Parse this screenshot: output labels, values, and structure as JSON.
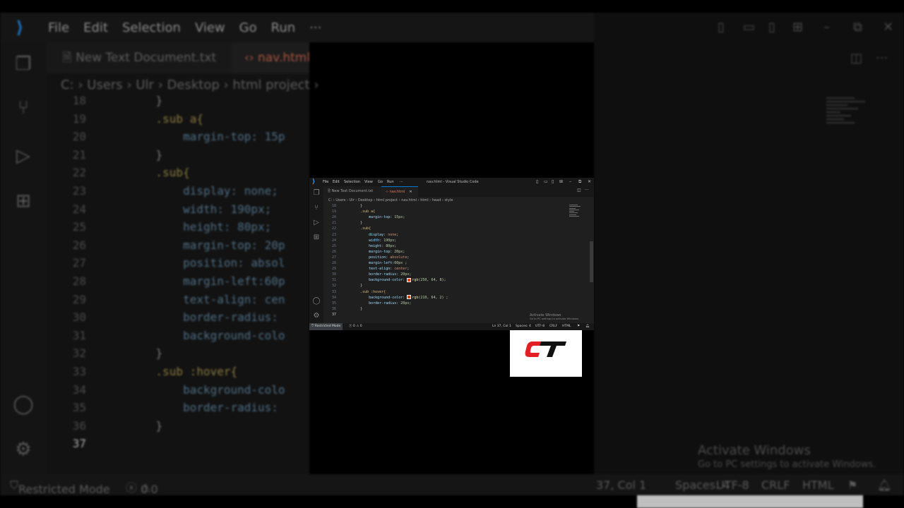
{
  "menu": [
    "File",
    "Edit",
    "Selection",
    "View",
    "Go",
    "Run",
    "···"
  ],
  "tabs": {
    "inactive": "New Text Document.txt",
    "active": "nav.html",
    "active_bg_visible": "nav.html"
  },
  "window_title": "nav.html - Visual Studio Code",
  "breadcrumb": {
    "bg": "C: › Users › Ulr › Desktop › html project ›",
    "small": [
      "C:",
      "Users",
      "Ulr",
      "Desktop",
      "html project",
      "nav.html",
      "html",
      "head",
      "style"
    ]
  },
  "code_lines": [
    {
      "n": "18",
      "parts": [
        {
          "t": "        }",
          "c": "txt"
        }
      ]
    },
    {
      "n": "19",
      "parts": [
        {
          "t": "        .sub a{",
          "c": "sel"
        }
      ]
    },
    {
      "n": "20",
      "parts": [
        {
          "t": "            margin-top",
          "c": "prop"
        },
        {
          "t": ": ",
          "c": "txt"
        },
        {
          "t": "15px",
          "c": "num"
        },
        {
          "t": ";",
          "c": "txt"
        }
      ]
    },
    {
      "n": "21",
      "parts": [
        {
          "t": "        }",
          "c": "txt"
        }
      ]
    },
    {
      "n": "22",
      "parts": [
        {
          "t": "        .sub{",
          "c": "sel"
        }
      ]
    },
    {
      "n": "23",
      "parts": [
        {
          "t": "            display",
          "c": "prop"
        },
        {
          "t": ": ",
          "c": "txt"
        },
        {
          "t": "none",
          "c": "val"
        },
        {
          "t": ";",
          "c": "txt"
        }
      ]
    },
    {
      "n": "24",
      "parts": [
        {
          "t": "            width",
          "c": "prop"
        },
        {
          "t": ": ",
          "c": "txt"
        },
        {
          "t": "190px",
          "c": "num"
        },
        {
          "t": ";",
          "c": "txt"
        }
      ]
    },
    {
      "n": "25",
      "parts": [
        {
          "t": "            height",
          "c": "prop"
        },
        {
          "t": ": ",
          "c": "txt"
        },
        {
          "t": "80px",
          "c": "num"
        },
        {
          "t": ";",
          "c": "txt"
        }
      ]
    },
    {
      "n": "26",
      "parts": [
        {
          "t": "            margin-top",
          "c": "prop"
        },
        {
          "t": ": ",
          "c": "txt"
        },
        {
          "t": "20px",
          "c": "num"
        },
        {
          "t": ";",
          "c": "txt"
        }
      ]
    },
    {
      "n": "27",
      "parts": [
        {
          "t": "            position",
          "c": "prop"
        },
        {
          "t": ": ",
          "c": "txt"
        },
        {
          "t": "absolute",
          "c": "val"
        },
        {
          "t": ";",
          "c": "txt"
        }
      ]
    },
    {
      "n": "28",
      "parts": [
        {
          "t": "            margin-left",
          "c": "prop"
        },
        {
          "t": ":",
          "c": "txt"
        },
        {
          "t": "60px",
          "c": "num"
        },
        {
          "t": " ;",
          "c": "txt"
        }
      ]
    },
    {
      "n": "29",
      "parts": [
        {
          "t": "            text-align",
          "c": "prop"
        },
        {
          "t": ": ",
          "c": "txt"
        },
        {
          "t": "center",
          "c": "val"
        },
        {
          "t": ";",
          "c": "txt"
        }
      ]
    },
    {
      "n": "30",
      "parts": [
        {
          "t": "            border-radius",
          "c": "prop"
        },
        {
          "t": ": ",
          "c": "txt"
        },
        {
          "t": "20px",
          "c": "num"
        },
        {
          "t": ";",
          "c": "txt"
        }
      ]
    },
    {
      "n": "31",
      "parts": [
        {
          "t": "            background-color",
          "c": "prop"
        },
        {
          "t": ": ",
          "c": "txt"
        },
        {
          "t": "#fa4008",
          "c": "swatch"
        },
        {
          "t": "rgb",
          "c": "fn"
        },
        {
          "t": "(",
          "c": "txt"
        },
        {
          "t": "250",
          "c": "num"
        },
        {
          "t": ", ",
          "c": "txt"
        },
        {
          "t": "64",
          "c": "num"
        },
        {
          "t": ", ",
          "c": "txt"
        },
        {
          "t": "8",
          "c": "num"
        },
        {
          "t": ");",
          "c": "txt"
        }
      ]
    },
    {
      "n": "32",
      "parts": [
        {
          "t": "        }",
          "c": "txt"
        }
      ]
    },
    {
      "n": "33",
      "parts": [
        {
          "t": "        .sub :hover{",
          "c": "sel"
        }
      ]
    },
    {
      "n": "34",
      "parts": [
        {
          "t": "            background-color",
          "c": "prop"
        },
        {
          "t": ": ",
          "c": "txt"
        },
        {
          "t": "#d24002",
          "c": "swatch"
        },
        {
          "t": "rgb",
          "c": "fn"
        },
        {
          "t": "(",
          "c": "txt"
        },
        {
          "t": "210",
          "c": "num"
        },
        {
          "t": ", ",
          "c": "txt"
        },
        {
          "t": "64",
          "c": "num"
        },
        {
          "t": ", ",
          "c": "txt"
        },
        {
          "t": "2",
          "c": "num"
        },
        {
          "t": ") ;",
          "c": "txt"
        }
      ]
    },
    {
      "n": "35",
      "parts": [
        {
          "t": "            border-radius",
          "c": "prop"
        },
        {
          "t": ": ",
          "c": "txt"
        },
        {
          "t": "20px",
          "c": "num"
        },
        {
          "t": ";",
          "c": "txt"
        }
      ]
    },
    {
      "n": "36",
      "parts": [
        {
          "t": "        }",
          "c": "txt"
        }
      ]
    },
    {
      "n": "37",
      "parts": [
        {
          "t": "",
          "c": "txt"
        }
      ]
    }
  ],
  "bg_code_lines": [
    {
      "n": "18",
      "t": "    }"
    },
    {
      "n": "19",
      "t": "    .sub a{"
    },
    {
      "n": "20",
      "t": "        margin-top: 15p"
    },
    {
      "n": "21",
      "t": "    }"
    },
    {
      "n": "22",
      "t": "    .sub{"
    },
    {
      "n": "23",
      "t": "        display: none;"
    },
    {
      "n": "24",
      "t": "        width: 190px;"
    },
    {
      "n": "25",
      "t": "        height: 80px;"
    },
    {
      "n": "26",
      "t": "        margin-top: 20p"
    },
    {
      "n": "27",
      "t": "        position: absol"
    },
    {
      "n": "28",
      "t": "        margin-left:60p"
    },
    {
      "n": "29",
      "t": "        text-align: cen"
    },
    {
      "n": "30",
      "t": "        border-radius:"
    },
    {
      "n": "31",
      "t": "        background-colo"
    },
    {
      "n": "32",
      "t": "    }"
    },
    {
      "n": "33",
      "t": "    .sub :hover{"
    },
    {
      "n": "34",
      "t": "        background-colo"
    },
    {
      "n": "35",
      "t": "        border-radius:"
    },
    {
      "n": "36",
      "t": "    }"
    },
    {
      "n": "37",
      "t": ""
    }
  ],
  "status": {
    "restricted": "Restricted Mode",
    "errors": "0",
    "warnings": "0",
    "position": "Ln 37, Col 1",
    "position_bg": "37, Col 1",
    "spaces": "Spaces: 4",
    "encoding": "UTF-8",
    "eol": "CRLF",
    "language": "HTML"
  },
  "activate": {
    "title": "Activate Windows",
    "subtitle": "Go to PC settings to activate Windows."
  },
  "logo_text": "CT",
  "colors": {
    "accent": "#0078d4",
    "tab_active": "#e07b5b",
    "logo_red": "#e31e24",
    "logo_black": "#111111"
  }
}
